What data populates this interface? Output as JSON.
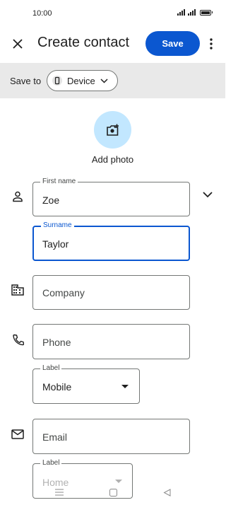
{
  "status_bar": {
    "time": "10:00"
  },
  "app_bar": {
    "title": "Create contact",
    "save_label": "Save"
  },
  "save_to": {
    "label": "Save to",
    "device_label": "Device"
  },
  "photo": {
    "label": "Add photo"
  },
  "name": {
    "first_label": "First name",
    "first_value": "Zoe",
    "surname_label": "Surname",
    "surname_value": "Taylor"
  },
  "company": {
    "placeholder": "Company"
  },
  "phone": {
    "placeholder": "Phone",
    "label_caption": "Label",
    "label_value": "Mobile"
  },
  "email": {
    "placeholder": "Email",
    "label_caption": "Label",
    "label_value": "Home"
  },
  "colors": {
    "accent": "#0b57d0",
    "photo_bg": "#c2e7ff",
    "save_bar_bg": "#e9e9e9"
  }
}
